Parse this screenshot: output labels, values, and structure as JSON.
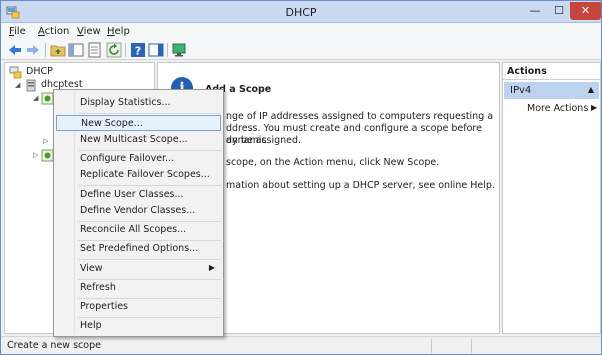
{
  "window": {
    "title": "DHCP",
    "controls": {
      "minimize": "—",
      "maximize": "☐",
      "close": "✕"
    }
  },
  "menubar": [
    {
      "label": "File",
      "accel": "F"
    },
    {
      "label": "Action",
      "accel": "A"
    },
    {
      "label": "View",
      "accel": "V"
    },
    {
      "label": "Help",
      "accel": "H"
    }
  ],
  "tree": {
    "root": "DHCP",
    "server": "dhcptest"
  },
  "center": {
    "heading": "Add a Scope",
    "para1_line1": "nge of IP addresses assigned to computers requesting a",
    "para1_line2": "ddress. You must create and configure a scope before dynamic",
    "para1_line3": "an be assigned.",
    "para2": "scope, on the Action menu, click New Scope.",
    "para3": "mation about setting up a DHCP server, see online Help."
  },
  "actions": {
    "header": "Actions",
    "section": "IPv4",
    "more": "More Actions"
  },
  "status": {
    "text": "Create a new scope"
  },
  "context_menu": {
    "items": [
      "Display Statistics...",
      "New Scope...",
      "New Multicast Scope...",
      "Configure Failover...",
      "Replicate Failover Scopes...",
      "Define User Classes...",
      "Define Vendor Classes...",
      "Reconcile All Scopes...",
      "Set Predefined Options...",
      "View",
      "Refresh",
      "Properties",
      "Help"
    ]
  },
  "colors": {
    "titlebar": "#c9daf2",
    "close_button": "#c7463b",
    "highlight": "#e5f1fb",
    "actions_section": "#bcd2ee"
  }
}
